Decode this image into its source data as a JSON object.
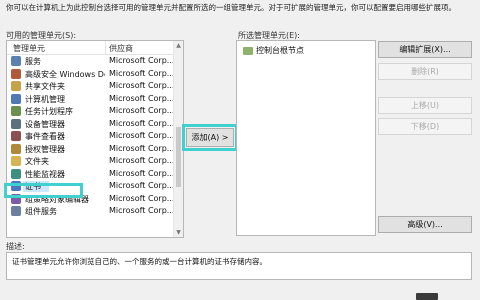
{
  "instruction": "你可以在计算机上为此控制台选择可用的管理单元并配置所选的一组管理单元。对于可扩展的管理单元，你可以配置要启用哪些扩展项。",
  "left_panel": {
    "label": "可用的管理单元(S):",
    "columns": [
      "管理单元",
      "供应商"
    ],
    "items": [
      {
        "name": "服务",
        "vendor": "Microsoft Corp...",
        "icon": "gear-icon",
        "color": "#5a7fb0"
      },
      {
        "name": "高级安全 Windows Def...",
        "vendor": "Microsoft Corp...",
        "icon": "firewall-icon",
        "color": "#b05a3a"
      },
      {
        "name": "共享文件夹",
        "vendor": "Microsoft Corp...",
        "icon": "shared-folder-icon",
        "color": "#c8a24a"
      },
      {
        "name": "计算机管理",
        "vendor": "Microsoft Corp...",
        "icon": "computer-icon",
        "color": "#4f79b4"
      },
      {
        "name": "任务计划程序",
        "vendor": "Microsoft Corp...",
        "icon": "clock-icon",
        "color": "#6b8f4e"
      },
      {
        "name": "设备管理器",
        "vendor": "Microsoft Corp...",
        "icon": "device-icon",
        "color": "#5c6f7d"
      },
      {
        "name": "事件查看器",
        "vendor": "Microsoft Corp...",
        "icon": "event-icon",
        "color": "#8e4f4f"
      },
      {
        "name": "授权管理器",
        "vendor": "Microsoft Corp...",
        "icon": "key-icon",
        "color": "#b08a3a"
      },
      {
        "name": "文件夹",
        "vendor": "Microsoft Corp...",
        "icon": "folder-icon",
        "color": "#d8b354"
      },
      {
        "name": "性能监视器",
        "vendor": "Microsoft Corp...",
        "icon": "chart-icon",
        "color": "#3f8f7e"
      },
      {
        "name": "证书",
        "vendor": "Microsoft Corp...",
        "icon": "certificate-icon",
        "color": "#4a76c2",
        "selected": true
      },
      {
        "name": "组策略对象编辑器",
        "vendor": "Microsoft Corp...",
        "icon": "policy-icon",
        "color": "#7a5ea8"
      },
      {
        "name": "组件服务",
        "vendor": "Microsoft Corp...",
        "icon": "component-icon",
        "color": "#6c7fa0"
      }
    ]
  },
  "add_button": "添加(A) >",
  "right_panel": {
    "label": "所选管理单元(E):",
    "root": "控制台根节点"
  },
  "buttons": {
    "edit_ext": "编辑扩展(X)...",
    "remove": "删除(R)",
    "move_up": "上移(U)",
    "move_down": "下移(D)",
    "advanced": "高级(V)..."
  },
  "description": {
    "label": "描述:",
    "text": "证书管理单元允许你浏览自己的、一个服务的或一台计算机的证书存储内容。"
  }
}
